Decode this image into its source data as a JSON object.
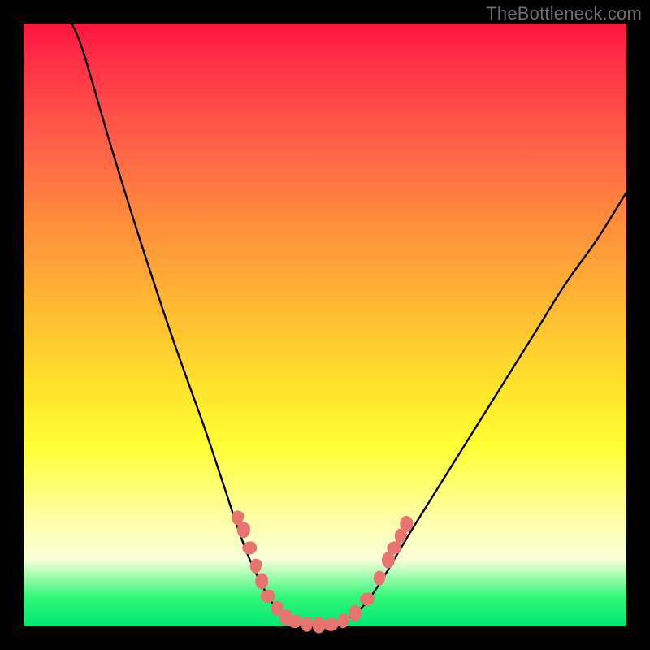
{
  "watermark": "TheBottleneck.com",
  "colors": {
    "curve_stroke": "#000000",
    "marker_fill": "#e8746f",
    "gradient_top": "#ff153f",
    "gradient_mid": "#ffe22c",
    "gradient_bottom": "#00e673",
    "frame": "#000000"
  },
  "chart_data": {
    "type": "line",
    "title": "",
    "xlabel": "",
    "ylabel": "",
    "xlim": [
      0,
      100
    ],
    "ylim": [
      0,
      100
    ],
    "curve_points": [
      {
        "x": 8,
        "y": 100
      },
      {
        "x": 10,
        "y": 95
      },
      {
        "x": 15,
        "y": 78
      },
      {
        "x": 20,
        "y": 62
      },
      {
        "x": 25,
        "y": 47
      },
      {
        "x": 30,
        "y": 33
      },
      {
        "x": 33,
        "y": 24
      },
      {
        "x": 36,
        "y": 15
      },
      {
        "x": 38,
        "y": 10
      },
      {
        "x": 40,
        "y": 6
      },
      {
        "x": 42,
        "y": 3
      },
      {
        "x": 45,
        "y": 1
      },
      {
        "x": 48,
        "y": 0
      },
      {
        "x": 50,
        "y": 0
      },
      {
        "x": 53,
        "y": 1
      },
      {
        "x": 56,
        "y": 3
      },
      {
        "x": 59,
        "y": 7
      },
      {
        "x": 62,
        "y": 12
      },
      {
        "x": 65,
        "y": 17
      },
      {
        "x": 70,
        "y": 25
      },
      {
        "x": 75,
        "y": 33
      },
      {
        "x": 80,
        "y": 41
      },
      {
        "x": 85,
        "y": 49
      },
      {
        "x": 90,
        "y": 57
      },
      {
        "x": 95,
        "y": 64
      },
      {
        "x": 100,
        "y": 72
      }
    ],
    "markers": [
      {
        "x": 35.5,
        "y": 18
      },
      {
        "x": 36.5,
        "y": 16
      },
      {
        "x": 37.5,
        "y": 13
      },
      {
        "x": 38.5,
        "y": 10
      },
      {
        "x": 39.5,
        "y": 7.5
      },
      {
        "x": 40.5,
        "y": 5
      },
      {
        "x": 42,
        "y": 3
      },
      {
        "x": 43.5,
        "y": 1.5
      },
      {
        "x": 45,
        "y": 0.8
      },
      {
        "x": 47,
        "y": 0.3
      },
      {
        "x": 49,
        "y": 0.2
      },
      {
        "x": 51,
        "y": 0.3
      },
      {
        "x": 53,
        "y": 0.9
      },
      {
        "x": 55,
        "y": 2.2
      },
      {
        "x": 57,
        "y": 4.5
      },
      {
        "x": 59,
        "y": 8
      },
      {
        "x": 60.5,
        "y": 11
      },
      {
        "x": 61.5,
        "y": 13
      },
      {
        "x": 62.5,
        "y": 15
      },
      {
        "x": 63.5,
        "y": 17
      }
    ]
  }
}
